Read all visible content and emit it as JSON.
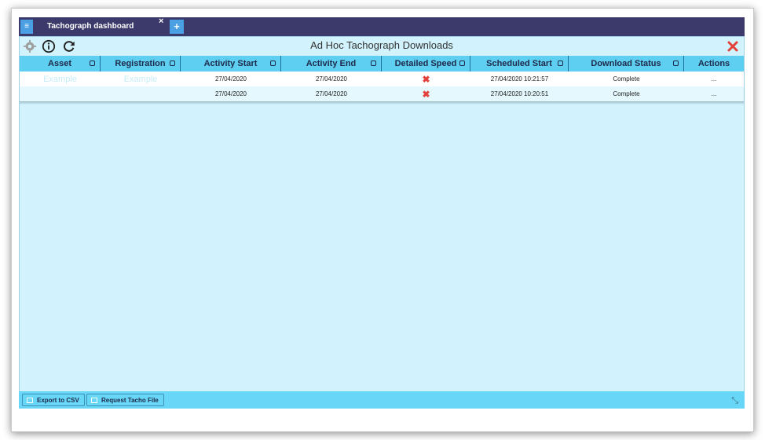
{
  "tabs": {
    "menu_glyph": "≡",
    "active_label": "Tachograph dashboard",
    "close_glyph": "×",
    "add_glyph": "+"
  },
  "panel": {
    "title": "Ad Hoc Tachograph Downloads"
  },
  "grid": {
    "columns": [
      "Asset",
      "Registration",
      "Activity Start",
      "Activity End",
      "Detailed Speed",
      "Scheduled Start",
      "Download Status",
      "Actions"
    ],
    "filter": {
      "asset_placeholder": "Example",
      "registration_placeholder": "Example"
    },
    "rows": [
      {
        "asset": "",
        "registration": "",
        "activity_start": "27/04/2020",
        "activity_end": "27/04/2020",
        "detailed_speed": "✖",
        "scheduled_start": "27/04/2020 10:21:57",
        "status": "Complete",
        "actions": "..."
      },
      {
        "asset": "",
        "registration": "",
        "activity_start": "27/04/2020",
        "activity_end": "27/04/2020",
        "detailed_speed": "✖",
        "scheduled_start": "27/04/2020 10:20:51",
        "status": "Complete",
        "actions": "..."
      }
    ]
  },
  "footer": {
    "export_label": "Export to CSV",
    "request_label": "Request Tacho File"
  },
  "colors": {
    "tabbar": "#3b3a6b",
    "accent": "#4aa0e2",
    "panel_bg": "#d2f3fd",
    "header_bg": "#5fcff1",
    "close_red": "#e3413a"
  }
}
